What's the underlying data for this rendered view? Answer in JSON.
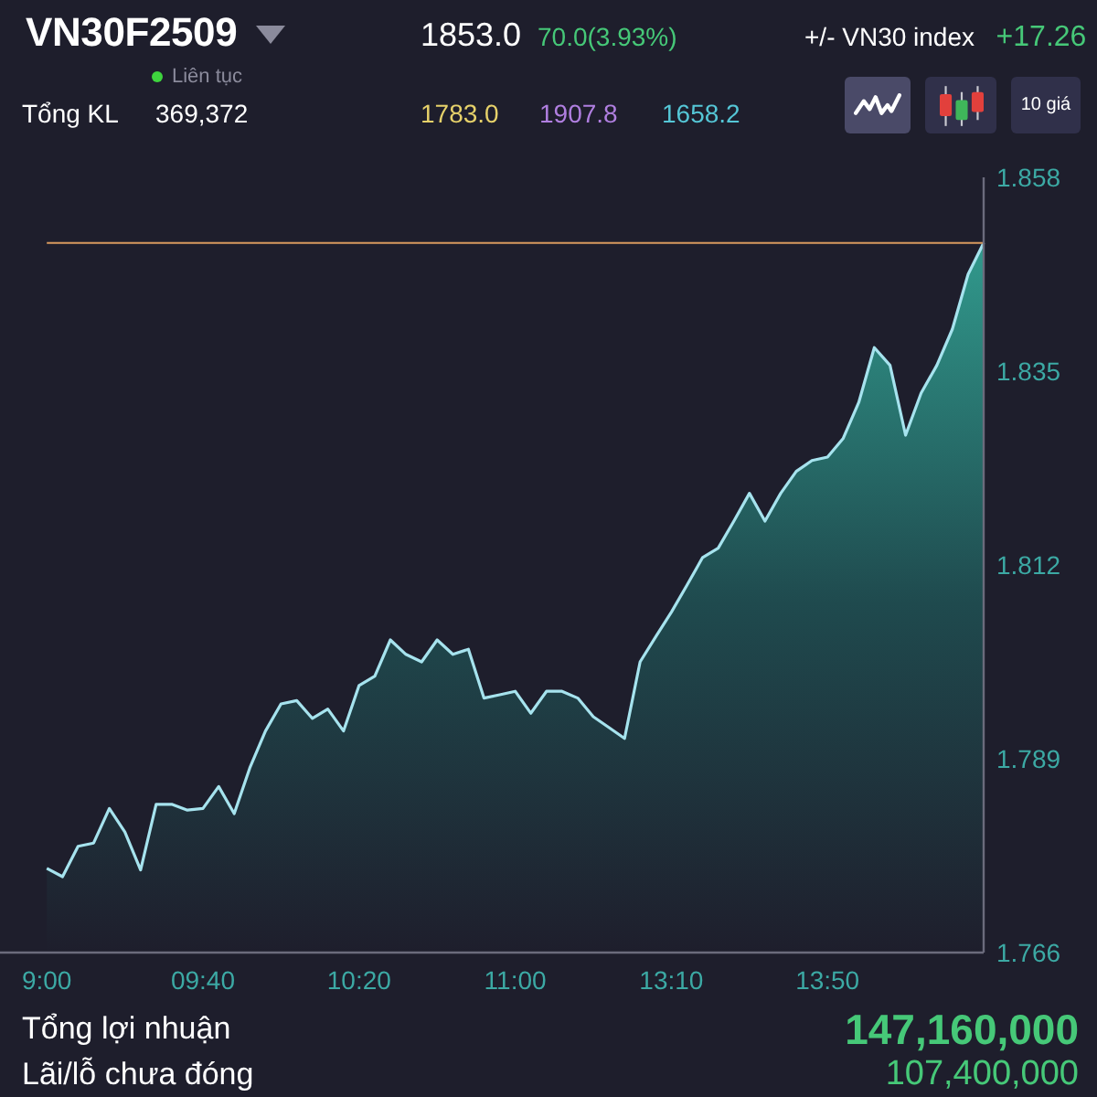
{
  "header": {
    "symbol": "VN30F2509",
    "price": "1853.0",
    "change": "70.0(3.93%)",
    "index_label": "+/- VN30 index",
    "index_change": "+17.26",
    "session": {
      "label": "Liên tục",
      "live": true
    },
    "volume_label": "Tổng KL",
    "volume": "369,372",
    "levels": [
      {
        "value": "1783.0",
        "color": "#e6d16a"
      },
      {
        "value": "1907.8",
        "color": "#b07fe0"
      },
      {
        "value": "1658.2",
        "color": "#55c6d6"
      }
    ],
    "chart_buttons": [
      {
        "kind": "line",
        "selected": true
      },
      {
        "kind": "candle",
        "selected": false
      },
      {
        "kind": "text",
        "label": "10 giá",
        "selected": false
      }
    ]
  },
  "chart": {
    "chart_data": {
      "type": "area",
      "categories": [
        null,
        null,
        null,
        "9:00",
        null,
        null,
        null,
        null,
        null,
        null,
        null,
        null,
        null,
        "09:40",
        null,
        null,
        null,
        null,
        null,
        null,
        null,
        null,
        null,
        "10:20",
        null,
        null,
        null,
        null,
        null,
        null,
        null,
        null,
        null,
        "11:00",
        null,
        null,
        null,
        null,
        null,
        null,
        null,
        null,
        null,
        "13:10",
        null,
        null,
        null,
        null,
        null,
        null,
        null,
        null,
        null,
        "13:50",
        null,
        null,
        null,
        null,
        null,
        null,
        null,
        null,
        null,
        null
      ],
      "values": [
        null,
        null,
        null,
        1.776,
        1.775,
        1.7786,
        1.779,
        1.7831,
        1.7803,
        1.7758,
        1.7836,
        1.7836,
        1.7829,
        1.7831,
        1.7857,
        1.7825,
        1.7879,
        1.7923,
        1.7955,
        1.7959,
        1.7938,
        1.7949,
        1.7923,
        1.7977,
        1.7988,
        1.8031,
        1.8014,
        1.8005,
        1.8031,
        1.8014,
        1.802,
        1.7962,
        1.7966,
        1.797,
        1.7944,
        1.797,
        1.797,
        1.7962,
        1.794,
        1.7927,
        1.7914,
        1.8005,
        1.8035,
        1.8064,
        1.8096,
        1.8129,
        1.814,
        1.8172,
        1.8205,
        1.8172,
        1.8205,
        1.8231,
        1.8244,
        1.8248,
        1.827,
        1.8313,
        1.8378,
        1.8357,
        1.8274,
        1.8324,
        1.8357,
        1.84,
        1.8465,
        1.8502
      ],
      "ylim": [
        1.766,
        1.858
      ],
      "yticks": [
        {
          "value": 1.858,
          "label": "1.858"
        },
        {
          "value": 1.835,
          "label": "1.835"
        },
        {
          "value": 1.812,
          "label": "1.812"
        },
        {
          "value": 1.789,
          "label": "1.789"
        },
        {
          "value": 1.766,
          "label": "1.766"
        }
      ],
      "ref_lines": [
        {
          "axis": "y",
          "value": 1.8502
        }
      ]
    }
  },
  "summary": [
    {
      "kind": "primary",
      "label": "Tổng lợi nhuận",
      "value": "147,160,000"
    },
    {
      "kind": "secondary",
      "label": "Lãi/lỗ chưa đóng",
      "value": "107,400,000"
    }
  ]
}
